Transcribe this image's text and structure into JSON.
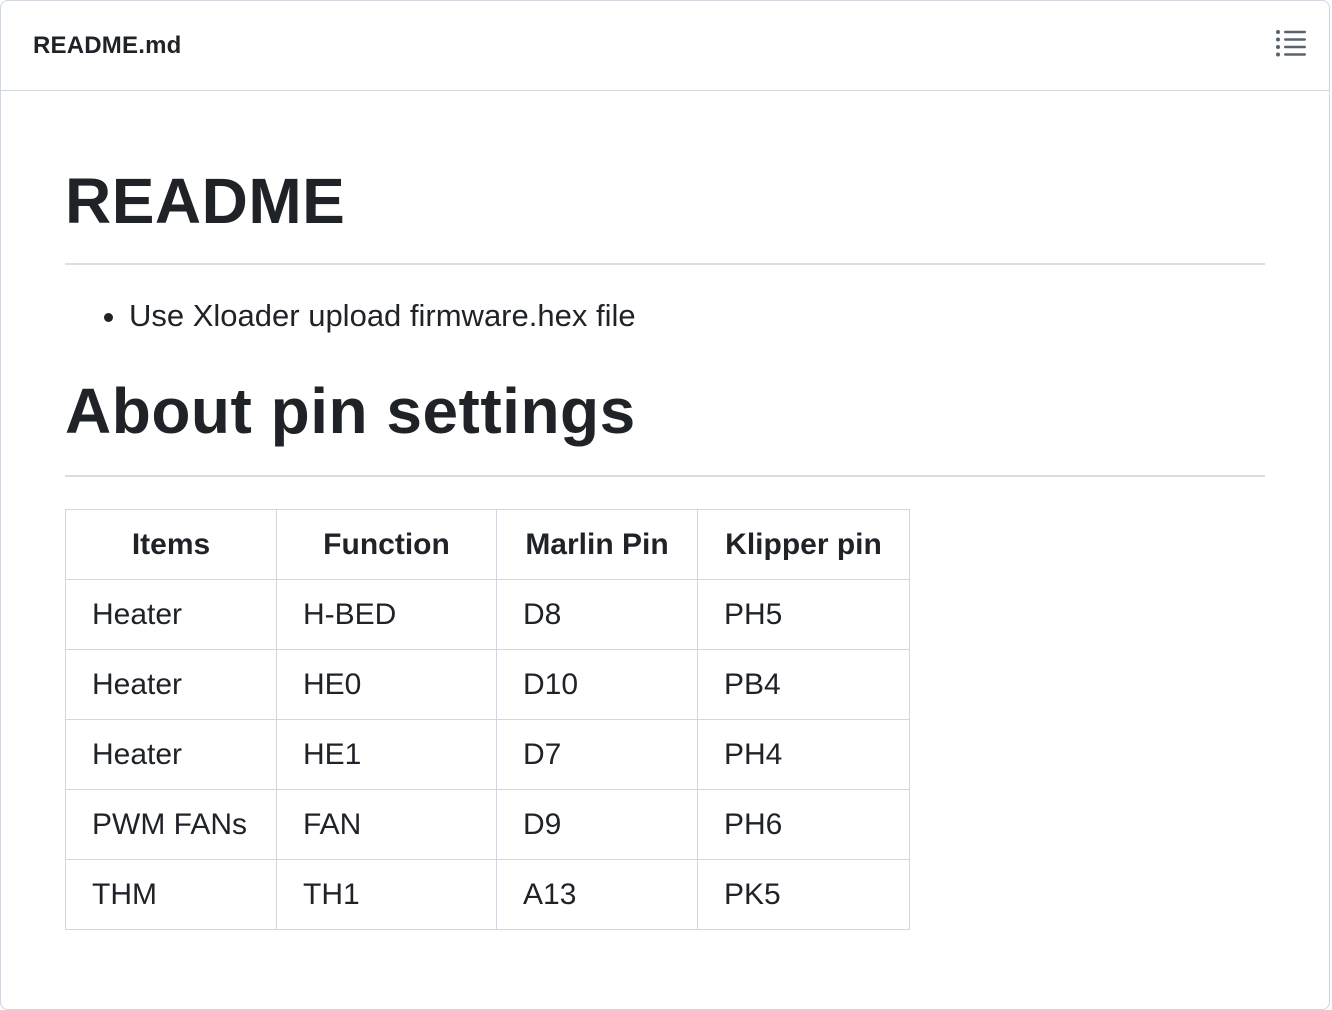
{
  "file_header": {
    "name": "README.md",
    "outline_icon": "list-unordered-icon"
  },
  "content": {
    "title": "README",
    "bullets": [
      "Use Xloader upload firmware.hex file"
    ],
    "section_title": "About pin settings",
    "table": {
      "headers": [
        "Items",
        "Function",
        "Marlin Pin",
        "Klipper pin"
      ],
      "rows": [
        [
          "Heater",
          "H-BED",
          "D8",
          "PH5"
        ],
        [
          "Heater",
          "HE0",
          "D10",
          "PB4"
        ],
        [
          "Heater",
          "HE1",
          "D7",
          "PH4"
        ],
        [
          "PWM FANs",
          "FAN",
          "D9",
          "PH6"
        ],
        [
          "THM",
          "TH1",
          "A13",
          "PK5"
        ]
      ]
    }
  },
  "colors": {
    "text": "#1f2328",
    "border": "#d0d7de",
    "icon": "#59636e"
  }
}
